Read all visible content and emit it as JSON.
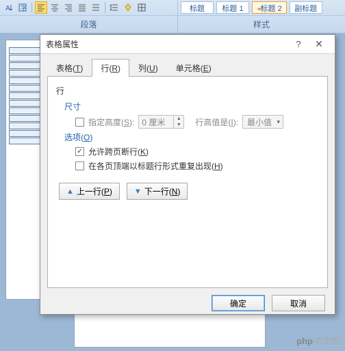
{
  "ribbon": {
    "section_paragraph": "段落",
    "section_styles": "样式",
    "styles": [
      "标题",
      "标题 1",
      "标题 2",
      "副标题"
    ]
  },
  "dialog": {
    "title": "表格属性",
    "help": "?",
    "close": "✕",
    "tabs": {
      "table": "表格(T)",
      "row": "行(R)",
      "column": "列(U)",
      "cell": "单元格(E)"
    },
    "panel": {
      "group_label": "行",
      "size_label": "尺寸",
      "specify_height_label": "指定高度(S):",
      "height_value": "0 厘米",
      "row_height_is_label": "行高值是(I):",
      "row_height_type": "最小值",
      "options_label": "选项(O)",
      "allow_break": "允许跨页断行(K)",
      "repeat_header": "在各页顶端以标题行形式重复出现(H)",
      "prev_row": "上一行(P)",
      "next_row": "下一行(N)"
    },
    "buttons": {
      "ok": "确定",
      "cancel": "取消"
    }
  },
  "watermark": "php中文网"
}
